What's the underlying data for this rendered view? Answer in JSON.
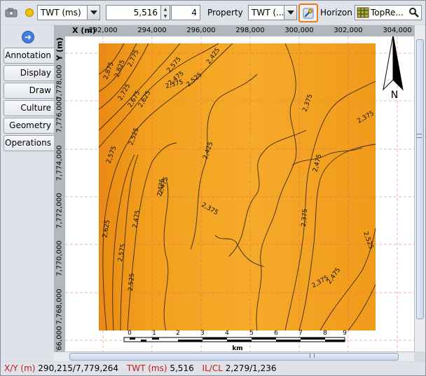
{
  "toolbar": {
    "camera_icon": "camera-icon",
    "status_dot_color": "#f2c200",
    "display_property": "TWT (ms)",
    "value": "5,516",
    "step": "4",
    "property_label": "Property",
    "property_value": "TWT (...",
    "horizon_label": "Horizon",
    "horizon_value": "TopRe..."
  },
  "tabs": [
    "Annotation",
    "Display",
    "Draw",
    "Culture",
    "Geometry",
    "Operations"
  ],
  "map": {
    "x_axis_name": "X (m)",
    "y_axis_name": "Y (m)",
    "x_ticks": [
      "292,000",
      "294,000",
      "296,000",
      "298,000",
      "300,000",
      "302,000",
      "304,000"
    ],
    "y_ticks": [
      "7,778,000",
      "7,776,000",
      "7,774,000",
      "7,772,000",
      "7,770,000",
      "7,768,000",
      "7,766,000"
    ],
    "north_label": "N",
    "scale_ticks": [
      "0",
      "1",
      "2",
      "3",
      "4",
      "5",
      "6",
      "7",
      "8",
      "9"
    ],
    "scale_unit": "km",
    "contour_labels": [
      "2,875",
      "2,825",
      "2,775",
      "2,725",
      "2,675",
      "2,625",
      "2,575",
      "2,525",
      "2,475",
      "2,425",
      "2,375",
      "2,575",
      "2,525",
      "2,475",
      "2,425",
      "2,375",
      "2,375",
      "2,375",
      "2,625",
      "2,575",
      "2,525",
      "2,475",
      "2,425",
      "2,375",
      "2,475",
      "2,525",
      "2,475",
      "2,375"
    ],
    "colors": {
      "fill": "#f5a01e",
      "fill_dark": "#e98a12",
      "contour": "#3a2a10",
      "grid": "#ee6b55"
    }
  },
  "status": {
    "xy_label": "X/Y (m)",
    "xy_value": "290,215/7,779,264",
    "twt_label": "TWT (ms)",
    "twt_value": "5,516",
    "ilcl_label": "IL/CL",
    "ilcl_value": "2,279/1,236"
  }
}
